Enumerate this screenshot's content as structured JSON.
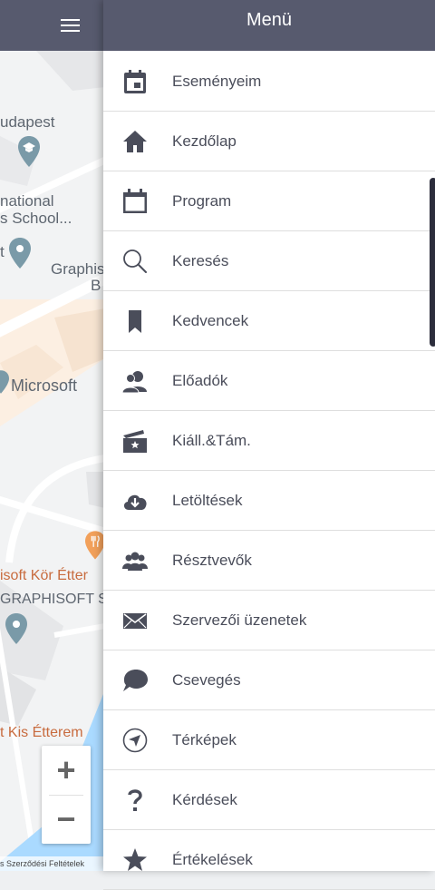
{
  "map": {
    "labels": {
      "budapest": "udapest",
      "national_1": "national",
      "national_2": "s School...",
      "pin_t": "t",
      "graphisoft_1": "Graphis",
      "graphisoft_2": "B",
      "microsoft": "Microsoft",
      "restaurant_1": "isoft Kör Étter",
      "restaurant_2": "GRAPHISOFT S",
      "restaurant_3": "t Kis Étterem"
    },
    "zoom_in": "+",
    "zoom_out": "−",
    "terms": "s Szerződési Feltételek"
  },
  "header": {
    "menu_icon": "hamburger-icon",
    "title": "Menü"
  },
  "menu": {
    "items": [
      {
        "label": "Eseményeim",
        "icon": "calendar-event-icon"
      },
      {
        "label": "Kezdőlap",
        "icon": "home-icon"
      },
      {
        "label": "Program",
        "icon": "calendar-icon"
      },
      {
        "label": "Keresés",
        "icon": "search-icon"
      },
      {
        "label": "Kedvencek",
        "icon": "bookmark-icon"
      },
      {
        "label": "Előadók",
        "icon": "speakers-icon"
      },
      {
        "label": "Kiáll.&Tám.",
        "icon": "exhibitor-ticket-icon"
      },
      {
        "label": "Letöltések",
        "icon": "cloud-download-icon"
      },
      {
        "label": "Résztvevők",
        "icon": "attendees-icon"
      },
      {
        "label": "Szervezői üzenetek",
        "icon": "envelope-icon"
      },
      {
        "label": "Csevegés",
        "icon": "chat-icon"
      },
      {
        "label": "Térképek",
        "icon": "navigation-icon"
      },
      {
        "label": "Kérdések",
        "icon": "question-icon"
      },
      {
        "label": "Értékelések",
        "icon": "star-icon"
      }
    ]
  },
  "colors": {
    "header_bg": "#575a6e",
    "icon": "#4a4d5a",
    "map_pin": "#7a9aa8",
    "map_orange": "#c86b3e",
    "water": "#aadaff"
  }
}
